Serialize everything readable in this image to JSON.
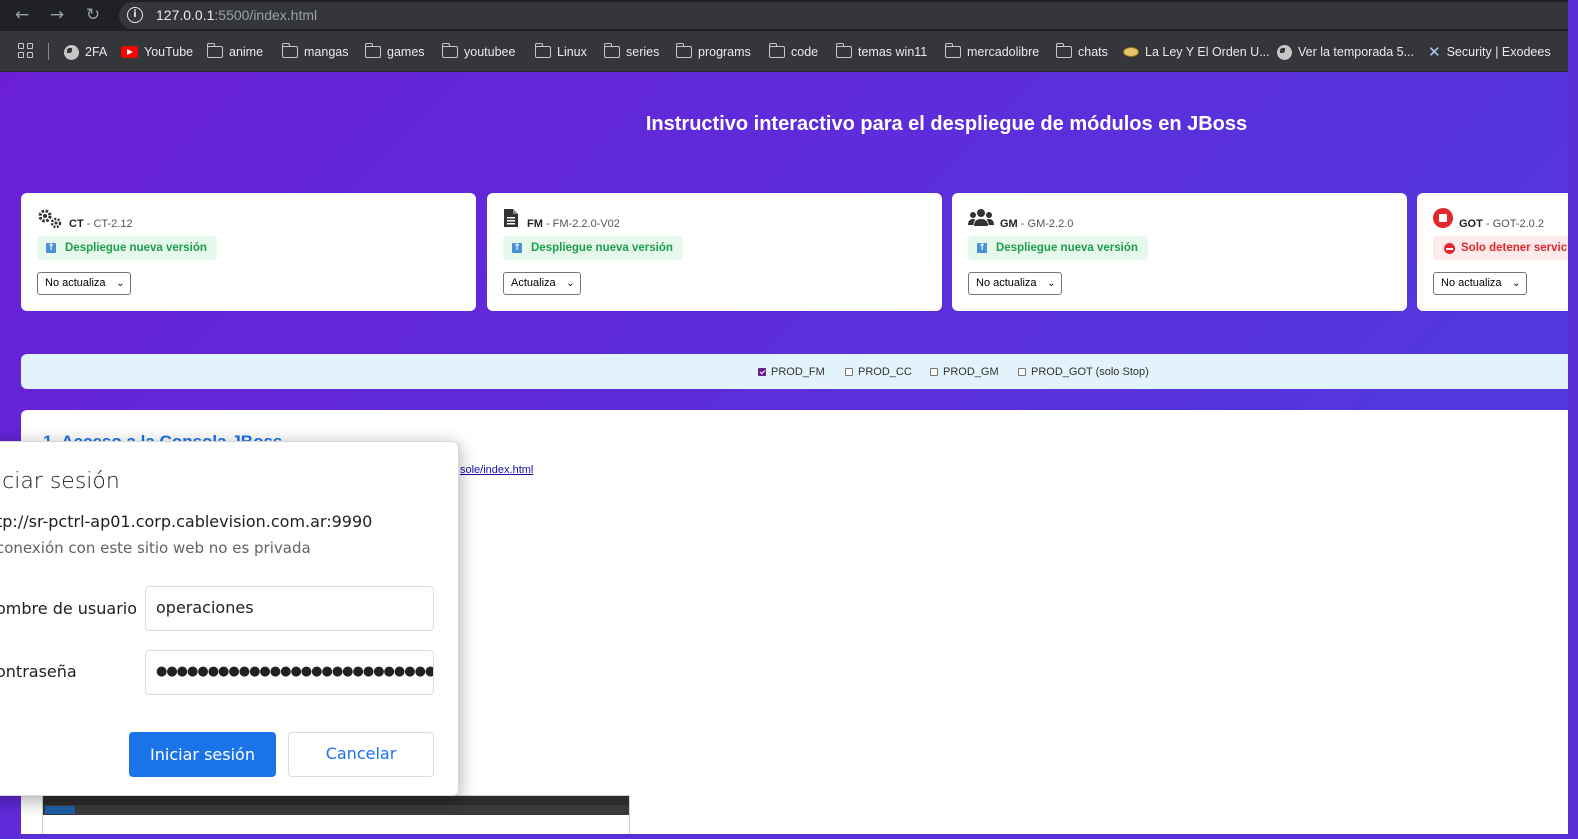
{
  "browser": {
    "url_host": "127.0.0.1",
    "url_rest": ":5500/index.html",
    "bookmarks": [
      {
        "label": "2FA",
        "icon": "globe-icon"
      },
      {
        "label": "YouTube",
        "icon": "youtube-icon"
      },
      {
        "label": "anime",
        "icon": "folder-icon"
      },
      {
        "label": "mangas",
        "icon": "folder-icon"
      },
      {
        "label": "games",
        "icon": "folder-icon"
      },
      {
        "label": "youtubee",
        "icon": "folder-icon"
      },
      {
        "label": "Linux",
        "icon": "folder-icon"
      },
      {
        "label": "series",
        "icon": "folder-icon"
      },
      {
        "label": "programs",
        "icon": "folder-icon"
      },
      {
        "label": "code",
        "icon": "folder-icon"
      },
      {
        "label": "temas win11",
        "icon": "folder-icon"
      },
      {
        "label": "mercadolibre",
        "icon": "folder-icon"
      },
      {
        "label": "chats",
        "icon": "folder-icon"
      },
      {
        "label": "La Ley Y El Orden U...",
        "icon": "site-icon"
      },
      {
        "label": "Ver la temporada 5...",
        "icon": "globe-icon"
      },
      {
        "label": "Security | Exodees",
        "icon": "security-icon"
      }
    ]
  },
  "page": {
    "title": "Instructivo interactivo para el despliegue de módulos en JBoss",
    "cards": [
      {
        "code": "CT",
        "version": "CT-2.12",
        "badge": "Despliegue nueva versión",
        "select": "No actualiza"
      },
      {
        "code": "FM",
        "version": "FM-2.2.0-V02",
        "badge": "Despliegue nueva versión",
        "select": "Actualiza"
      },
      {
        "code": "GM",
        "version": "GM-2.2.0",
        "badge": "Despliegue nueva versión",
        "select": "No actualiza"
      },
      {
        "code": "GOT",
        "version": "GOT-2.0.2",
        "badge": "Solo detener servicio",
        "select": "No actualiza"
      }
    ],
    "checks": [
      {
        "label": "PROD_FM",
        "checked": true
      },
      {
        "label": "PROD_CC",
        "checked": false
      },
      {
        "label": "PROD_GM",
        "checked": false
      },
      {
        "label": "PROD_GOT (solo Stop)",
        "checked": false
      }
    ],
    "step_title": "1. Acceso a la Consola JBoss",
    "step_link": "sole/index.html"
  },
  "dialog": {
    "title": "iciar sesión",
    "url": "tp://sr-pctrl-ap01.corp.cablevision.com.ar:9990",
    "subtitle": "conexión con este sitio web no es privada",
    "username_label": "ombre de usuario",
    "username_value": "operaciones",
    "password_label": "ontraseña",
    "password_value": "●●●●●●●●●●●●●●●●●●●●●●●●●●●",
    "login_button": "Iniciar sesión",
    "cancel_button": "Cancelar"
  },
  "colors": {
    "accent": "#1a73e8",
    "success": "#1e9e4a",
    "danger": "#e0282e",
    "background_gradient_start": "#6a1fd6",
    "background_gradient_end": "#4a3de0"
  }
}
